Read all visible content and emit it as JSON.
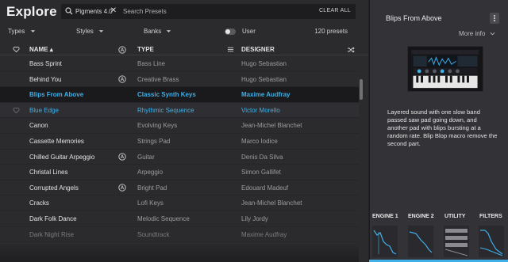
{
  "header": {
    "title": "Explore",
    "search_chip": "Pigments 4.0",
    "search_placeholder": "Search Presets",
    "clear_all": "CLEAR ALL"
  },
  "filters": {
    "types": "Types",
    "styles": "Styles",
    "banks": "Banks",
    "user": "User",
    "preset_count": "120 presets"
  },
  "columns": {
    "name": "NAME",
    "type": "TYPE",
    "designer": "DESIGNER"
  },
  "presets": [
    {
      "name": "Bass Sprint",
      "type": "Bass Line",
      "designer": "Hugo Sebastian",
      "user": false
    },
    {
      "name": "Behind You",
      "type": "Creative Brass",
      "designer": "Hugo Sebastian",
      "user": true
    },
    {
      "name": "Blips From Above",
      "type": "Classic Synth Keys",
      "designer": "Maxime Audfray",
      "user": false
    },
    {
      "name": "Blue Edge",
      "type": "Rhythmic Sequence",
      "designer": "Victor Morello",
      "user": false
    },
    {
      "name": "Canon",
      "type": "Evolving Keys",
      "designer": "Jean-Michel Blanchet",
      "user": false
    },
    {
      "name": "Cassette Memories",
      "type": "Strings Pad",
      "designer": "Marco Iodice",
      "user": false
    },
    {
      "name": "Chilled Guitar Arpeggio",
      "type": "Guitar",
      "designer": "Denis Da Silva",
      "user": true
    },
    {
      "name": "Christal Lines",
      "type": "Arpeggio",
      "designer": "Simon Gallifet",
      "user": false
    },
    {
      "name": "Corrupted Angels",
      "type": "Bright Pad",
      "designer": "Edouard Madeuf",
      "user": true
    },
    {
      "name": "Cracks",
      "type": "Lofi Keys",
      "designer": "Jean-Michel Blanchet",
      "user": false
    },
    {
      "name": "Dark Folk Dance",
      "type": "Melodic Sequence",
      "designer": "Lily Jordy",
      "user": false
    },
    {
      "name": "Dark Night Rise",
      "type": "Soundtrack",
      "designer": "Maxime Audfray",
      "user": false
    }
  ],
  "selected_index": 2,
  "hover_index": 3,
  "details": {
    "title": "Blips From Above",
    "more_info": "More info",
    "description": "Layered sound with one slow band passed saw pad going down, and another pad with blips bursting at a random rate. Blip Blop macro remove the second part.",
    "tabs": [
      "ENGINE 1",
      "ENGINE 2",
      "UTILITY",
      "FILTERS"
    ]
  },
  "colors": {
    "accent": "#3fb0e8",
    "background": "#2b2b2e",
    "panel": "#333337"
  }
}
